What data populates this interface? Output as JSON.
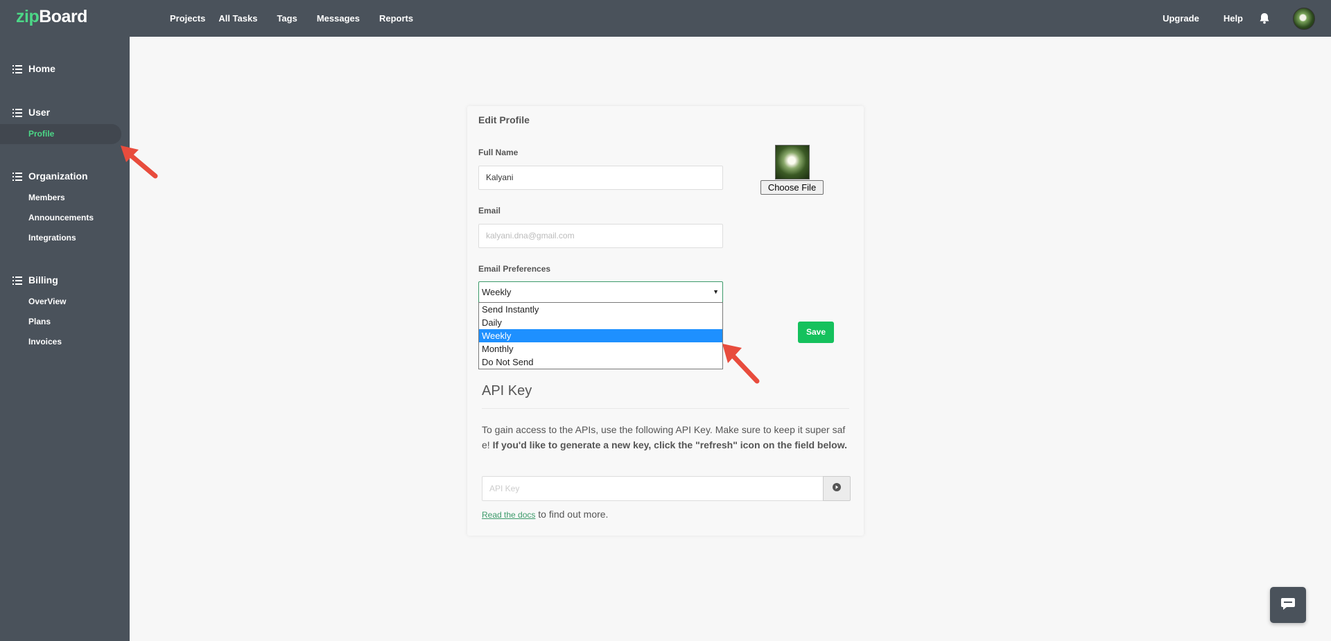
{
  "brand": {
    "zip": "zip",
    "board": "Board"
  },
  "topnav": [
    "Projects",
    "All Tasks",
    "Tags",
    "Messages",
    "Reports"
  ],
  "topright": {
    "upgrade": "Upgrade",
    "help": "Help"
  },
  "sidebar": {
    "home": "Home",
    "user": {
      "title": "User",
      "items": [
        "Profile"
      ]
    },
    "organization": {
      "title": "Organization",
      "items": [
        "Members",
        "Announcements",
        "Integrations"
      ]
    },
    "billing": {
      "title": "Billing",
      "items": [
        "OverView",
        "Plans",
        "Invoices"
      ]
    }
  },
  "form": {
    "title": "Edit Profile",
    "full_name_label": "Full Name",
    "full_name_value": "Kalyani",
    "email_label": "Email",
    "email_placeholder": "kalyani.dna@gmail.com",
    "pref_label": "Email Preferences",
    "pref_selected": "Weekly",
    "pref_options": [
      "Send Instantly",
      "Daily",
      "Weekly",
      "Monthly",
      "Do Not Send"
    ],
    "choose_file": "Choose File",
    "save": "Save"
  },
  "api": {
    "title": "API Key",
    "desc_plain": "To gain access to the APIs, use the following API Key. Make sure to keep it super safe! ",
    "desc_bold": "If you'd like to generate a new key, click the \"refresh\" icon on the field below.",
    "placeholder": "API Key",
    "docs_link": "Read the docs",
    "docs_tail": " to find out more."
  },
  "colors": {
    "accent": "#4cd787",
    "header": "#4a525b",
    "save": "#15c15d",
    "highlight": "#1e90ff",
    "arrow": "#e84c3d"
  },
  "icons": [
    "list-icon",
    "bell-icon",
    "refresh-icon",
    "chat-icon",
    "caret-down-icon"
  ]
}
